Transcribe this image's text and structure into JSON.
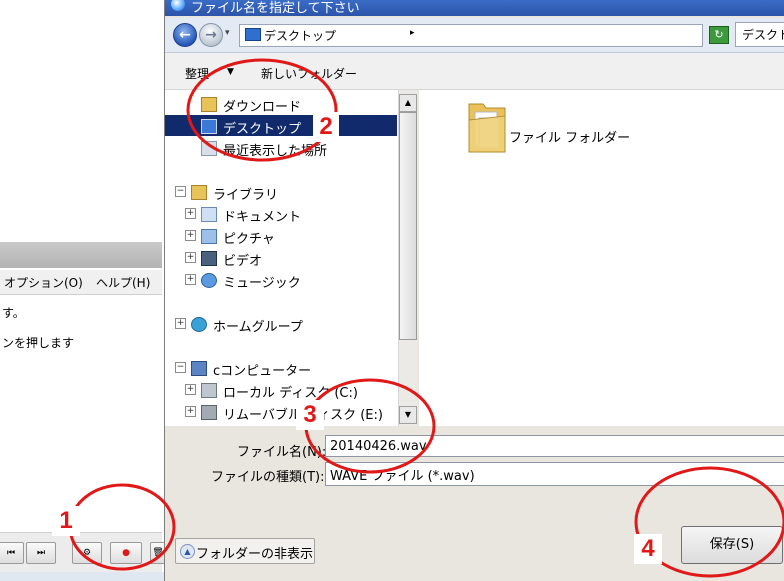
{
  "background_app": {
    "menu": [
      "オプション(O)",
      "ヘルプ(H)"
    ],
    "lines": [
      "す。",
      "ンを押します"
    ],
    "toolbar": [
      "⏮",
      "⏭",
      "⚙",
      "●",
      "🗑"
    ]
  },
  "dialog": {
    "title": "ファイル名を指定して下さい",
    "address": "デスクトップ",
    "search_placeholder": "デスクト",
    "organize_label": "整理",
    "new_folder_label": "新しいフォルダー",
    "nav": [
      {
        "label": "ダウンロード",
        "icon": "download-folder-icon"
      },
      {
        "label": "デスクトップ",
        "icon": "desktop-icon",
        "selected": true
      },
      {
        "label": "最近表示した場所",
        "icon": "recent-places-icon"
      },
      {
        "label": "ライブラリ",
        "icon": "library-icon",
        "expander": "−"
      },
      {
        "label": "ドキュメント",
        "icon": "documents-icon",
        "expander": "+"
      },
      {
        "label": "ピクチャ",
        "icon": "pictures-icon",
        "expander": "+"
      },
      {
        "label": "ビデオ",
        "icon": "videos-icon",
        "expander": "+"
      },
      {
        "label": "ミュージック",
        "icon": "music-icon",
        "expander": "+"
      },
      {
        "label": "ホームグループ",
        "icon": "homegroup-icon",
        "expander": "+"
      },
      {
        "label": "cコンピューター",
        "icon": "computer-icon",
        "expander": "−"
      },
      {
        "label": "ローカル ディスク (C:)",
        "icon": "local-disk-icon",
        "expander": "+"
      },
      {
        "label": "リムーバブル ディスク (E:)",
        "icon": "removable-disk-icon",
        "expander": "+"
      }
    ],
    "content_item": "ファイル フォルダー",
    "filename_label": "ファイル名(N):",
    "filename_value": "20140426.wav",
    "filetype_label": "ファイルの種類(T):",
    "filetype_value": "WAVE ファイル (*.wav)",
    "hide_folders_label": "フォルダーの非表示",
    "save_label": "保存(S)"
  },
  "annotations": [
    "1",
    "2",
    "3",
    "4"
  ],
  "colors": {
    "annotation": "#e01818",
    "selection": "#102a6b",
    "titlebar": "#2c54a9"
  }
}
